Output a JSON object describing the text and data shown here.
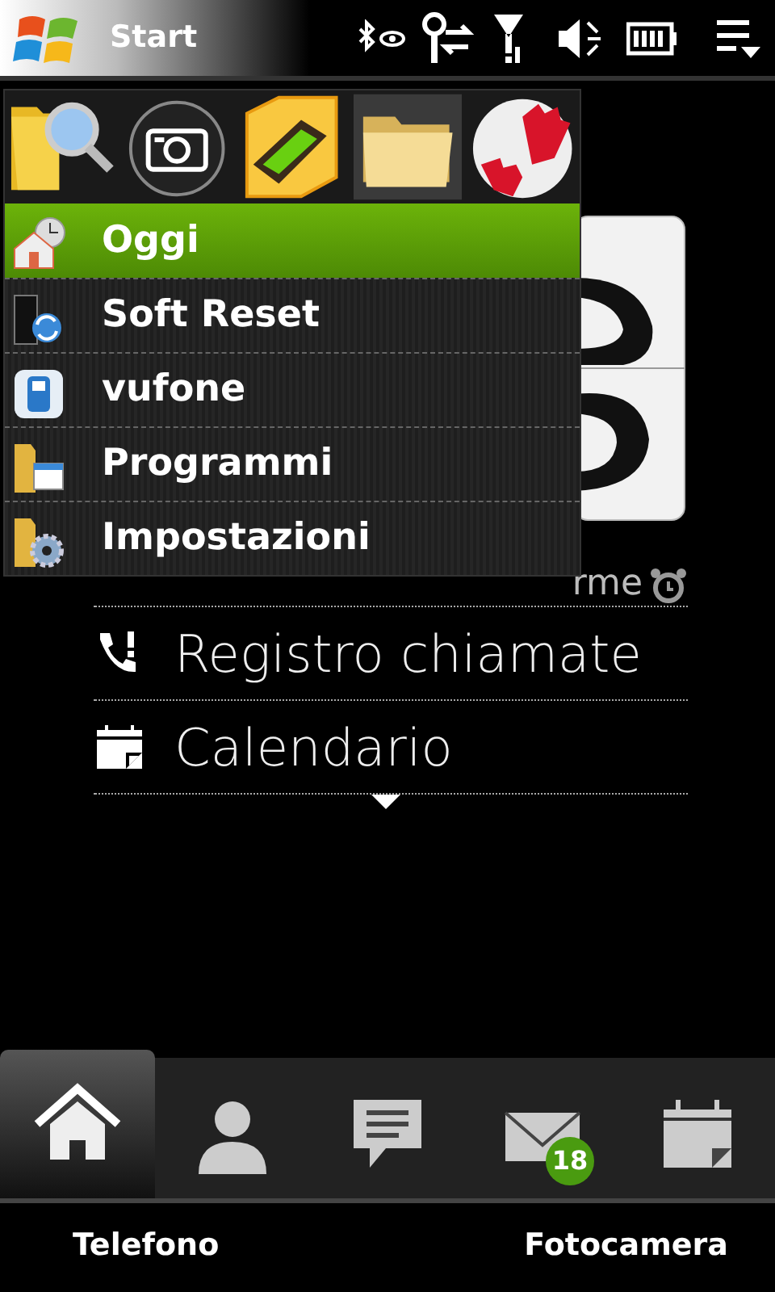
{
  "status_bar": {
    "title": "Start"
  },
  "start_menu": {
    "apps": [
      {
        "kind": "search"
      },
      {
        "kind": "camera"
      },
      {
        "kind": "phone"
      },
      {
        "kind": "folder"
      },
      {
        "kind": "hands"
      }
    ],
    "items": [
      {
        "label": "Oggi",
        "kind": "home",
        "selected": true
      },
      {
        "label": "Soft Reset",
        "kind": "reset",
        "selected": false
      },
      {
        "label": "vufone",
        "kind": "phone",
        "selected": false
      },
      {
        "label": "Programmi",
        "kind": "programs",
        "selected": false
      },
      {
        "label": "Impostazioni",
        "kind": "settings",
        "selected": false
      }
    ]
  },
  "home": {
    "alarm_text": "rme",
    "rows": [
      {
        "label": "Registro chiamate",
        "kind": "calllog"
      },
      {
        "label": "Calendario",
        "kind": "calendar"
      }
    ]
  },
  "tabs": [
    {
      "kind": "home",
      "selected": true
    },
    {
      "kind": "person",
      "selected": false
    },
    {
      "kind": "message",
      "selected": false
    },
    {
      "kind": "mail",
      "selected": false,
      "badge": "18"
    },
    {
      "kind": "calendar",
      "selected": false
    }
  ],
  "softkeys": [
    "Telefono",
    "Fotocamera"
  ]
}
